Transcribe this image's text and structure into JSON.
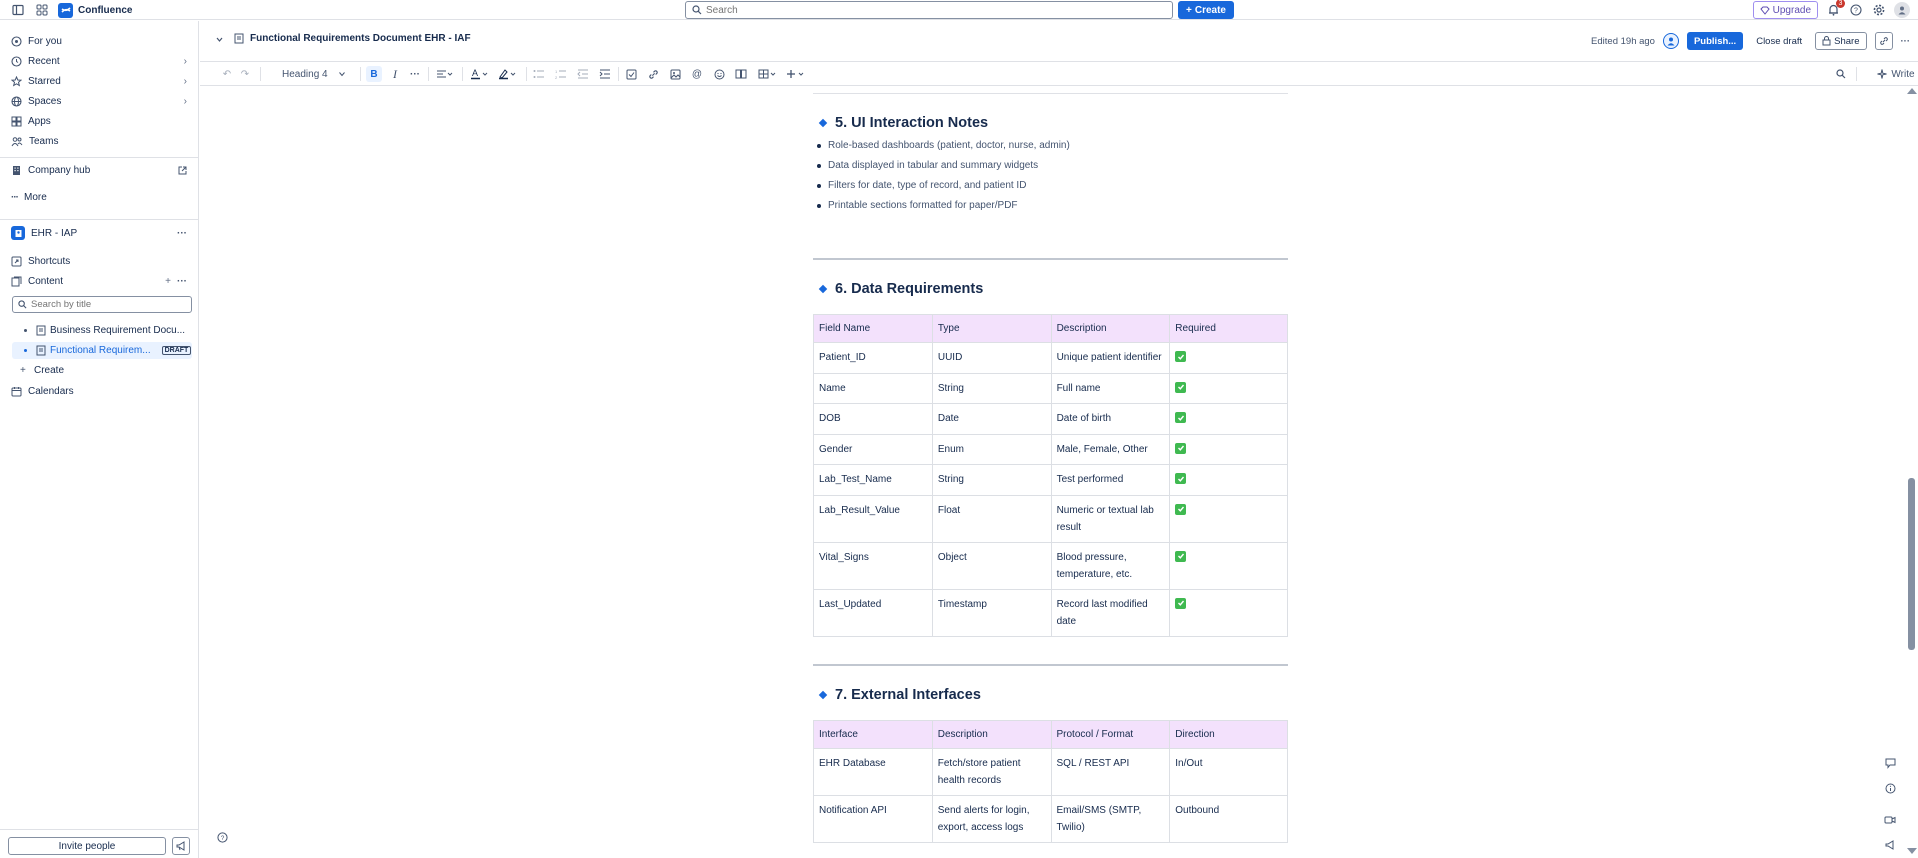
{
  "topnav": {
    "app_name": "Confluence",
    "search_placeholder": "Search",
    "create_label": "Create",
    "upgrade_label": "Upgrade",
    "notification_count": "3"
  },
  "sidebar": {
    "items": [
      {
        "label": "For you"
      },
      {
        "label": "Recent"
      },
      {
        "label": "Starred"
      },
      {
        "label": "Spaces"
      },
      {
        "label": "Apps"
      },
      {
        "label": "Teams"
      },
      {
        "label": "Company hub"
      },
      {
        "label": "More"
      }
    ],
    "space_name": "EHR - IAP",
    "shortcuts_label": "Shortcuts",
    "content_label": "Content",
    "search_placeholder": "Search by title",
    "tree": [
      {
        "label": "Business Requirement Docu..."
      },
      {
        "label": "Functional Requirem...",
        "tag": "DRAFT"
      }
    ],
    "create_label": "Create",
    "calendars_label": "Calendars",
    "invite_label": "Invite people"
  },
  "page": {
    "title": "Functional Requirements Document EHR - IAF",
    "edited": "Edited 19h ago",
    "publish_label": "Publish...",
    "close_draft_label": "Close draft",
    "share_label": "Share"
  },
  "toolbar": {
    "text_style": "Heading 4",
    "write_label": "Write"
  },
  "doc": {
    "section5": {
      "heading": "5. UI Interaction Notes",
      "bullets": [
        "Role-based dashboards (patient, doctor, nurse, admin)",
        "Data displayed in tabular and summary widgets",
        "Filters for date, type of record, and patient ID",
        "Printable sections formatted for paper/PDF"
      ]
    },
    "section6": {
      "heading": "6. Data Requirements",
      "columns": [
        "Field Name",
        "Type",
        "Description",
        "Required"
      ],
      "rows": [
        {
          "field": "Patient_ID",
          "type": "UUID",
          "description": "Unique patient identifier",
          "required": true
        },
        {
          "field": "Name",
          "type": "String",
          "description": "Full name",
          "required": true
        },
        {
          "field": "DOB",
          "type": "Date",
          "description": "Date of birth",
          "required": true
        },
        {
          "field": "Gender",
          "type": "Enum",
          "description": "Male, Female, Other",
          "required": true
        },
        {
          "field": "Lab_Test_Name",
          "type": "String",
          "description": "Test performed",
          "required": true
        },
        {
          "field": "Lab_Result_Value",
          "type": "Float",
          "description": "Numeric or textual lab result",
          "required": true
        },
        {
          "field": "Vital_Signs",
          "type": "Object",
          "description": "Blood pressure, temperature, etc.",
          "required": true
        },
        {
          "field": "Last_Updated",
          "type": "Timestamp",
          "description": "Record last modified date",
          "required": true
        }
      ]
    },
    "section7": {
      "heading": "7. External Interfaces",
      "columns": [
        "Interface",
        "Description",
        "Protocol / Format",
        "Direction"
      ],
      "rows": [
        {
          "interface": "EHR Database",
          "description": "Fetch/store patient health records",
          "protocol": "SQL / REST API",
          "direction": "In/Out"
        },
        {
          "interface": "Notification API",
          "description": "Send alerts for login, export, access logs",
          "protocol": "Email/SMS (SMTP, Twilio)",
          "direction": "Outbound"
        }
      ]
    }
  },
  "colors": {
    "accent": "#1868db",
    "table_header_bg": "#f3e1fc",
    "check_green": "#3fb950",
    "upgrade_purple": "#5e4db2"
  }
}
